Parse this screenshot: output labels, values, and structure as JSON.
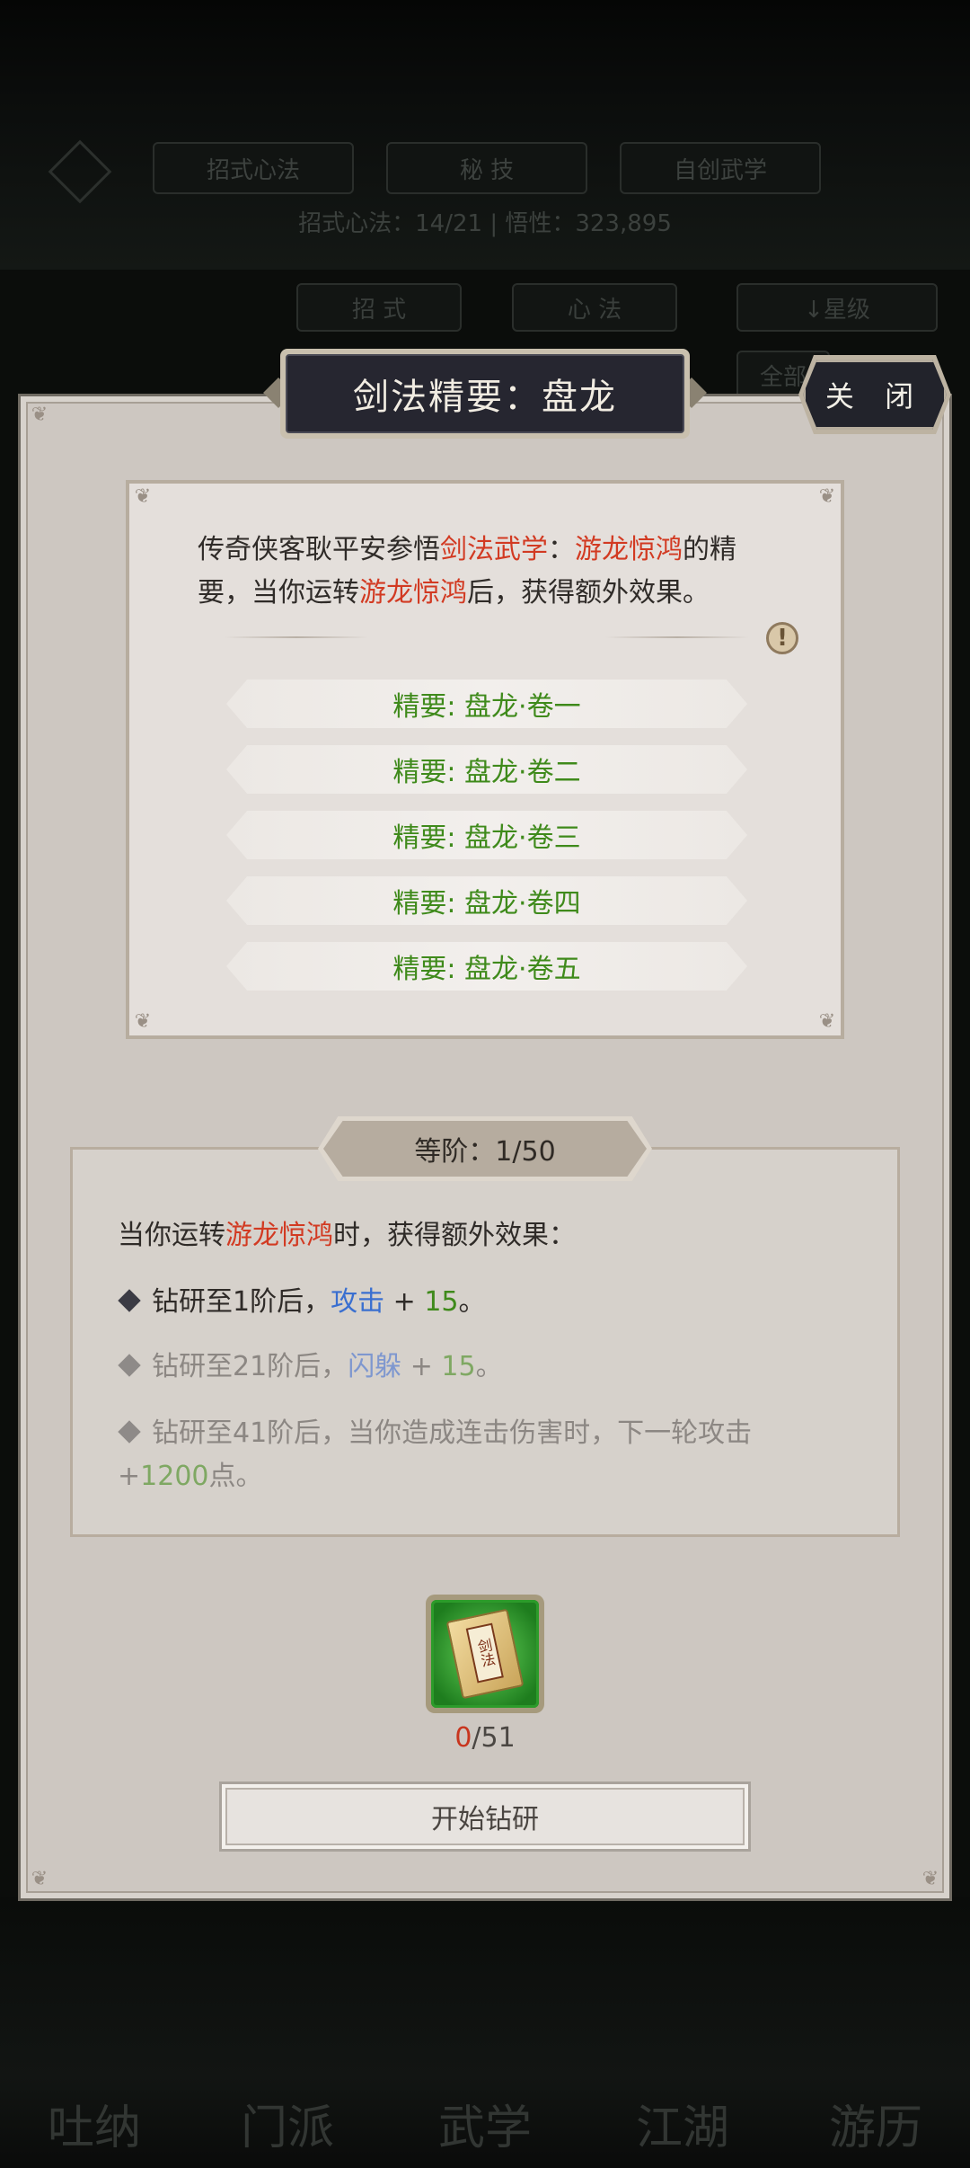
{
  "background": {
    "tabs": [
      "招式心法",
      "秘 技",
      "自创武学"
    ],
    "subtitle": "招式心法：14/21 | 悟性：323,895",
    "sub_tabs": [
      "招 式",
      "心 法"
    ],
    "sort_label": "↓星级",
    "filter_label": "全部",
    "nav": [
      "吐纳",
      "门派",
      "武学",
      "江湖",
      "游历"
    ]
  },
  "dialog": {
    "title": "剑法精要：盘龙",
    "close_label": "关 闭",
    "intro": {
      "part1": "传奇侠客耿平安参悟",
      "highlight1": "剑法武学",
      "part2": "：",
      "highlight2": "游龙惊鸿",
      "part3": "的精要，当你运转",
      "highlight3": "游龙惊鸿",
      "part4": "后，获得额外效果。"
    },
    "warn_icon": "!",
    "volumes": [
      "精要: 盘龙·卷一",
      "精要: 盘龙·卷二",
      "精要: 盘龙·卷三",
      "精要: 盘龙·卷四",
      "精要: 盘龙·卷五"
    ],
    "level_label": "等阶：1/50",
    "effect_head": {
      "part1": "当你运转",
      "highlight": "游龙惊鸿",
      "part2": "时，获得额外效果："
    },
    "effects": [
      {
        "prefix": "钻研至1阶后，",
        "stat": "攻击",
        "plus": " + ",
        "value": "15",
        "suffix": "。"
      },
      {
        "prefix": "钻研至21阶后，",
        "stat": "闪躲",
        "plus": " + ",
        "value": "15",
        "suffix": "。"
      },
      {
        "prefix": "钻研至41阶后，当你造成连击伤害时，下一轮攻击+",
        "value": "1200",
        "suffix": "点。"
      }
    ],
    "item": {
      "icon": "sword-manual-icon",
      "glyph": "剑法",
      "have": "0",
      "need": "/51"
    },
    "start_label": "开始钻研"
  }
}
